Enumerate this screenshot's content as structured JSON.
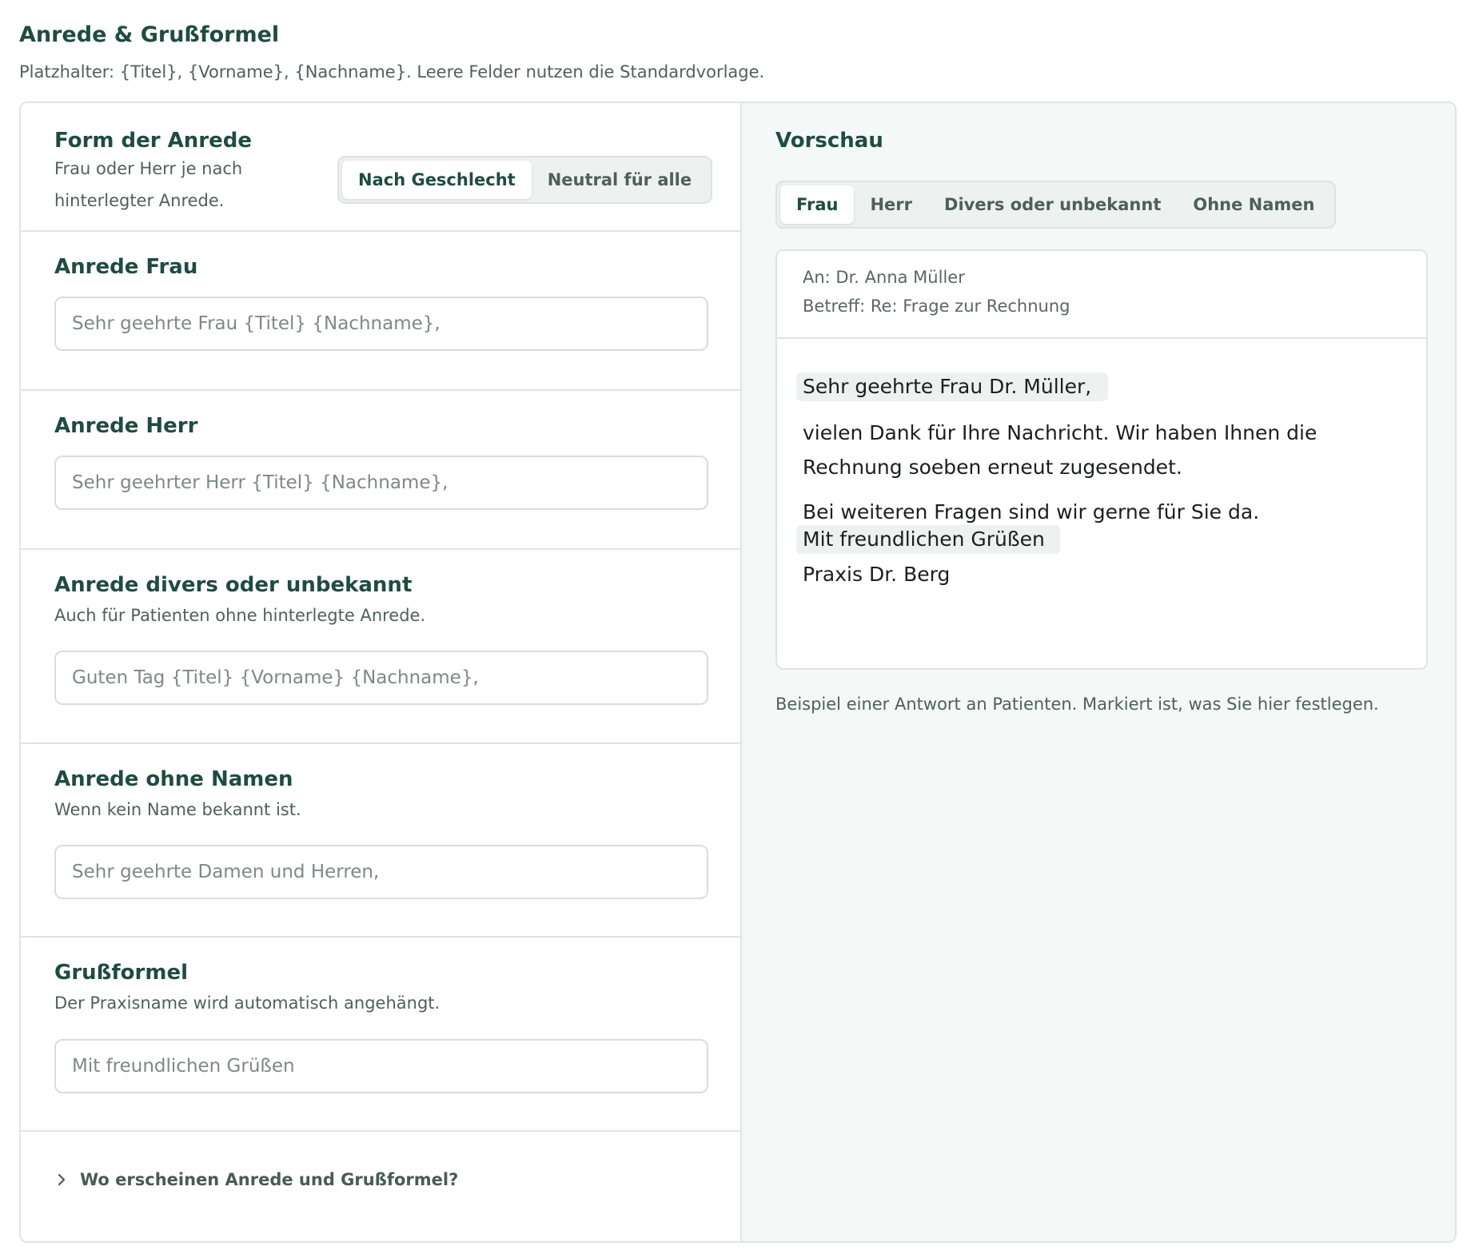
{
  "header": {
    "title": "Anrede & Grußformel",
    "subtitle": "Platzhalter: {Titel}, {Vorname}, {Nachname}. Leere Felder nutzen die Standardvorlage."
  },
  "form": {
    "title": "Form der Anrede",
    "desc_line1": "Frau oder Herr je nach",
    "desc_line2": "hinterlegter Anrede.",
    "options": [
      "Nach Geschlecht",
      "Neutral für alle"
    ],
    "selected": "Nach Geschlecht"
  },
  "fields": {
    "frau": {
      "title": "Anrede Frau",
      "placeholder": "Sehr geehrte Frau {Titel} {Nachname},",
      "value": ""
    },
    "herr": {
      "title": "Anrede Herr",
      "placeholder": "Sehr geehrter Herr {Titel} {Nachname},",
      "value": ""
    },
    "divers": {
      "title": "Anrede divers oder unbekannt",
      "desc": "Auch für Patienten ohne hinterlegte Anrede.",
      "placeholder": "Guten Tag {Titel} {Vorname} {Nachname},",
      "value": ""
    },
    "ohne_namen": {
      "title": "Anrede ohne Namen",
      "desc": "Wenn kein Name bekannt ist.",
      "placeholder": "Sehr geehrte Damen und Herren,",
      "value": ""
    },
    "gruss": {
      "title": "Grußformel",
      "desc": "Der Praxisname wird automatisch angehängt.",
      "placeholder": "Mit freundlichen Grüßen",
      "value": ""
    }
  },
  "disclosure": {
    "label": "Wo erscheinen Anrede und Grußformel?",
    "icon": "chevron-right-icon"
  },
  "preview": {
    "title": "Vorschau",
    "tabs": [
      "Frau",
      "Herr",
      "Divers oder unbekannt",
      "Ohne Namen"
    ],
    "selected_tab": "Frau",
    "to": "An: Dr. Anna Müller",
    "subject": "Betreff: Re: Frage zur Rechnung",
    "salutation": "Sehr geehrte Frau Dr. Müller,",
    "body_line1": "vielen Dank für Ihre Nachricht. Wir haben Ihnen die",
    "body_line2": "Rechnung soeben erneut zugesendet.",
    "body_line3": "Bei weiteren Fragen sind wir gerne für Sie da.",
    "closing": "Mit freundlichen Grüßen",
    "signature": "Praxis Dr. Berg",
    "caption": "Beispiel einer Antwort an Patienten. Markiert ist, was Sie hier festlegen."
  },
  "colors": {
    "accent": "#1f4b42",
    "highlight": "#edf2f1",
    "border": "#dfe5e3",
    "preview_bg": "#f4f8f7"
  }
}
